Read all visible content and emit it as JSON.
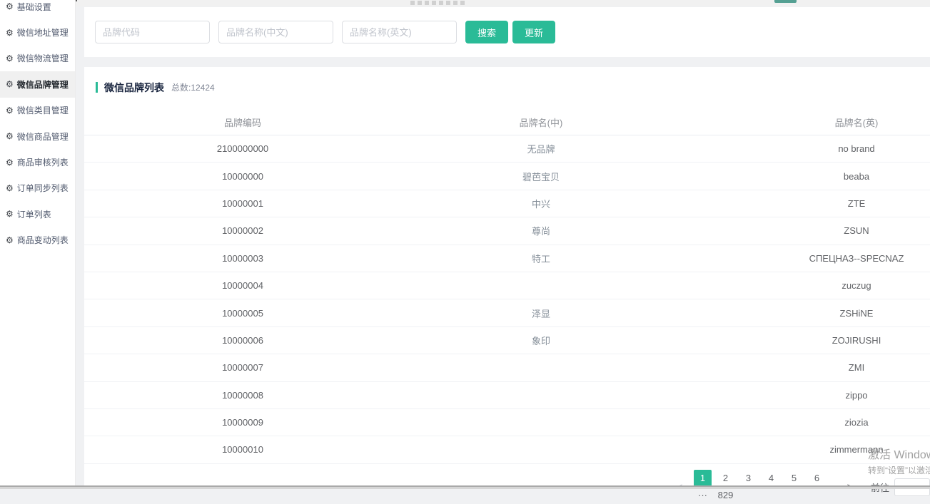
{
  "colors": {
    "accent": "#2abb97",
    "sidebar_active_bg": "#f0f0f0"
  },
  "icons": {
    "gear": "⚙",
    "prev": "<",
    "next": ">",
    "more": "···"
  },
  "sidebar": {
    "items": [
      {
        "key": "basic-settings",
        "label": "基础设置",
        "active": false
      },
      {
        "key": "wechat-address",
        "label": "微信地址管理",
        "active": false
      },
      {
        "key": "wechat-logistics",
        "label": "微信物流管理",
        "active": false
      },
      {
        "key": "wechat-brand",
        "label": "微信品牌管理",
        "active": true
      },
      {
        "key": "wechat-category",
        "label": "微信类目管理",
        "active": false
      },
      {
        "key": "wechat-product",
        "label": "微信商品管理",
        "active": false
      },
      {
        "key": "product-audit",
        "label": "商品审核列表",
        "active": false
      },
      {
        "key": "order-sync",
        "label": "订单同步列表",
        "active": false
      },
      {
        "key": "order-list",
        "label": "订单列表",
        "active": false
      },
      {
        "key": "product-change",
        "label": "商品变动列表",
        "active": false
      }
    ]
  },
  "search": {
    "inputs": [
      {
        "placeholder": "品牌代码"
      },
      {
        "placeholder": "品牌名称(中文)"
      },
      {
        "placeholder": "品牌名称(英文)"
      }
    ],
    "buttons": [
      {
        "label": "搜索"
      },
      {
        "label": "更新"
      }
    ]
  },
  "list": {
    "title": "微信品牌列表",
    "total": "总数:12424",
    "columns": [
      "品牌编码",
      "品牌名(中)",
      "品牌名(英)"
    ],
    "rows": [
      {
        "code": "2100000000",
        "zh": "无品牌",
        "en": "no brand"
      },
      {
        "code": "10000000",
        "zh": "碧芭宝贝",
        "en": "beaba"
      },
      {
        "code": "10000001",
        "zh": "中兴",
        "en": "ZTE"
      },
      {
        "code": "10000002",
        "zh": "尊尚",
        "en": "ZSUN"
      },
      {
        "code": "10000003",
        "zh": "特工",
        "en": "СПЕЦНАЗ--SPECNAZ"
      },
      {
        "code": "10000004",
        "zh": "",
        "en": "zuczug"
      },
      {
        "code": "10000005",
        "zh": "泽显",
        "en": "ZSHiNE"
      },
      {
        "code": "10000006",
        "zh": "象印",
        "en": "ZOJIRUSHI"
      },
      {
        "code": "10000007",
        "zh": "",
        "en": "ZMI"
      },
      {
        "code": "10000008",
        "zh": "",
        "en": "zippo"
      },
      {
        "code": "10000009",
        "zh": "",
        "en": "ziozia"
      },
      {
        "code": "10000010",
        "zh": "",
        "en": "zimmermann"
      }
    ]
  },
  "pagination": {
    "pages": [
      "1",
      "2",
      "3",
      "4",
      "5",
      "6",
      "···",
      "829"
    ],
    "active_page": "1",
    "goto_label": "前往"
  },
  "watermark": {
    "line1": "激活 Windows",
    "line2": "转到“设置”以激活 Windows"
  }
}
